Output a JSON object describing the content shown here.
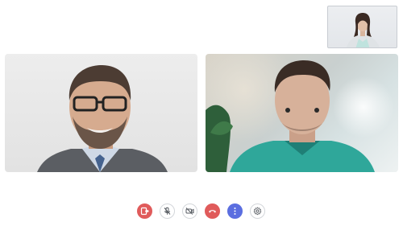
{
  "call": {
    "self_view": {
      "icon": "self-camera-preview"
    },
    "participants": [
      {
        "icon": "participant-video-man-glasses"
      },
      {
        "icon": "participant-video-man-teal-shirt"
      }
    ]
  },
  "controls": [
    {
      "icon": "share-screen-icon",
      "style": "red"
    },
    {
      "icon": "microphone-off-icon",
      "style": "outline"
    },
    {
      "icon": "camera-off-icon",
      "style": "outline"
    },
    {
      "icon": "end-call-icon",
      "style": "red"
    },
    {
      "icon": "more-options-icon",
      "style": "blue"
    },
    {
      "icon": "settings-icon",
      "style": "outline"
    }
  ],
  "colors": {
    "danger": "#e05b5b",
    "accent": "#5b6ee0",
    "outline": "#d3d6da"
  }
}
